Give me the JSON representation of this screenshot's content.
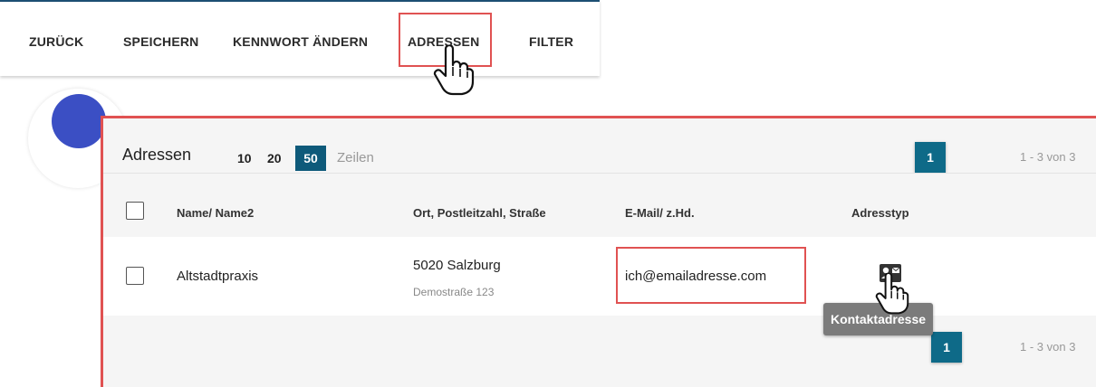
{
  "toolbar": {
    "back_label": "ZURÜCK",
    "save_label": "SPEICHERN",
    "change_password_label": "KENNWORT ÄNDERN",
    "addresses_label": "ADRESSEN",
    "filter_label": "FILTER"
  },
  "panel": {
    "title": "Adressen",
    "page_sizes": [
      "10",
      "20",
      "50"
    ],
    "active_page_size": "50",
    "rows_label": "Zeilen",
    "current_page": "1",
    "range_text": "1 - 3 von 3"
  },
  "table": {
    "columns": [
      "Name/ Name2",
      "Ort, Postleitzahl, Straße",
      "E-Mail/ z.Hd.",
      "Adresstyp"
    ],
    "rows": [
      {
        "name": "Altstadtpraxis",
        "city": "5020 Salzburg",
        "street": "Demostraße 123",
        "email": "ich@emailadresse.com",
        "type_icon": "contact-card-icon"
      }
    ]
  },
  "tooltip": {
    "text": "Kontaktadresse"
  },
  "footer": {
    "current_page": "1",
    "range_text": "1 - 3 von 3"
  },
  "colors": {
    "accent": "#0e5a7a",
    "highlight": "#e05252",
    "tooltip_bg": "#7b7b7b"
  }
}
